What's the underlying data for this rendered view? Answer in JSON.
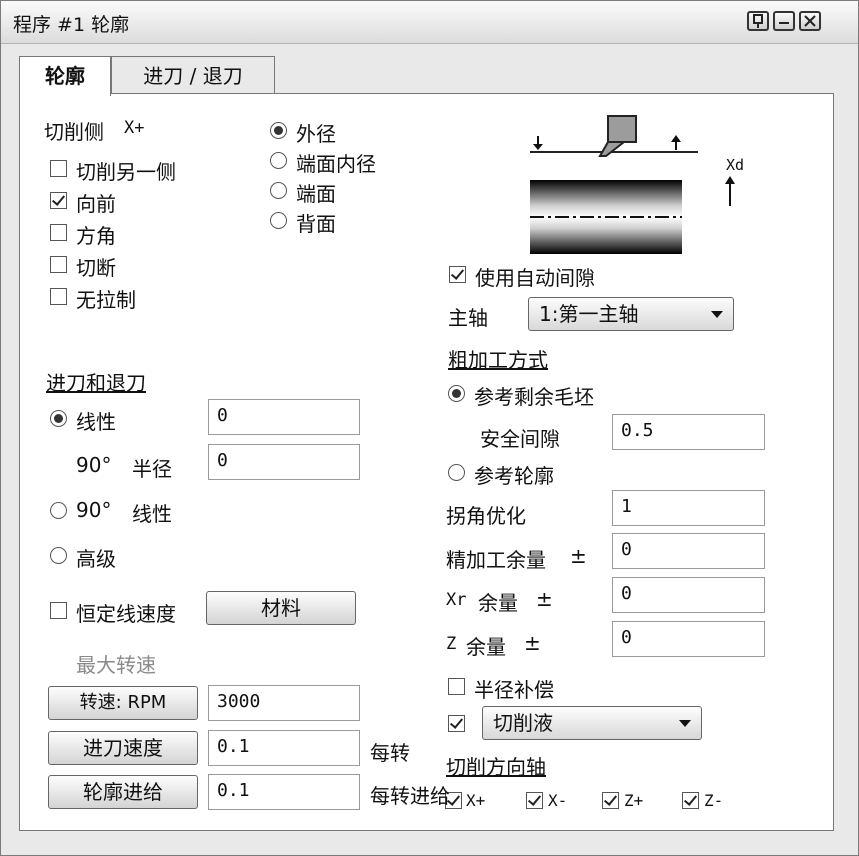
{
  "window": {
    "title": "程序 #1 轮廓"
  },
  "tabs": [
    {
      "label": "轮廓"
    },
    {
      "label": "进刀 / 退刀"
    }
  ],
  "cut_side": {
    "label": "切削侧",
    "value": "X+"
  },
  "options": [
    {
      "label": "切削另一侧",
      "checked": false
    },
    {
      "label": "向前",
      "checked": true
    },
    {
      "label": "方角",
      "checked": false
    },
    {
      "label": "切断",
      "checked": false
    },
    {
      "label": "无拉制",
      "checked": false
    }
  ],
  "cut_location": [
    {
      "label": "外径",
      "selected": true
    },
    {
      "label": "端面内径",
      "selected": false
    },
    {
      "label": "端面",
      "selected": false
    },
    {
      "label": "背面",
      "selected": false
    }
  ],
  "diagram": {
    "axis_label": "Xd"
  },
  "auto_gap": {
    "label": "使用自动间隙",
    "checked": true
  },
  "spindle": {
    "label": "主轴",
    "value": "1:第一主轴"
  },
  "rough_method": {
    "heading": "粗加工方式",
    "ref_stock": {
      "label": "参考剩余毛坯",
      "selected": true
    },
    "safety_gap": {
      "label": "安全间隙",
      "value": "0.5"
    },
    "ref_contour": {
      "label": "参考轮廓",
      "selected": false
    }
  },
  "corner_opt": {
    "label": "拐角优化",
    "value": "1"
  },
  "finish_allow": {
    "label": "精加工余量",
    "sign": "±",
    "value": "0"
  },
  "xr_allow": {
    "label_prefix": "Xr",
    "label": "余量",
    "sign": "±",
    "value": "0"
  },
  "z_allow": {
    "label_prefix": "Z",
    "label": "余量",
    "sign": "±",
    "value": "0"
  },
  "radius_comp": {
    "label": "半径补偿",
    "checked": false
  },
  "coolant": {
    "checked": true,
    "value": "切削液"
  },
  "cut_dir": {
    "heading": "切削方向轴",
    "items": [
      {
        "label": "X+",
        "checked": true
      },
      {
        "label": "X-",
        "checked": true
      },
      {
        "label": "Z+",
        "checked": true
      },
      {
        "label": "Z-",
        "checked": true
      }
    ]
  },
  "approach": {
    "heading": "进刀和退刀",
    "linear": {
      "label": "线性",
      "value": "0",
      "selected": true
    },
    "radius90": {
      "label_a": "90°",
      "label_b": "半径",
      "value": "0"
    },
    "linear90": {
      "label_a": "90°",
      "label_b": "线性",
      "selected": false
    },
    "advanced": {
      "label": "高级",
      "selected": false
    }
  },
  "const_speed": {
    "label": "恒定线速度",
    "checked": false
  },
  "material_button": "材料",
  "max_speed_label": "最大转速",
  "rpm": {
    "button": "转速: RPM",
    "value": "3000"
  },
  "feed": {
    "button": "进刀速度",
    "value": "0.1",
    "unit": "每转"
  },
  "contour_feed": {
    "button": "轮廓进给",
    "value": "0.1",
    "unit": "每转进给"
  }
}
